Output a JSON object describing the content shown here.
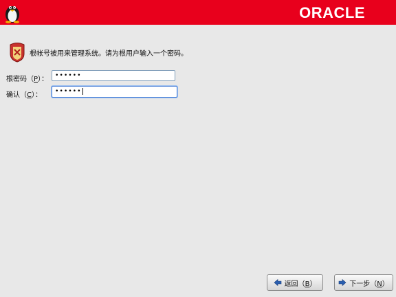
{
  "banner": {
    "logo_text": "ORACLE",
    "color": "#e8001c"
  },
  "content": {
    "intro_text": "根帐号被用来管理系统。请为根用户输入一个密码。"
  },
  "form": {
    "root_password": {
      "label_prefix": "根密码（",
      "mnemonic": "P",
      "label_suffix": "）：",
      "value_masked": "••••••"
    },
    "confirm": {
      "label_prefix": "确认（",
      "mnemonic": "C",
      "label_suffix": "）：",
      "value_masked": "••••••"
    }
  },
  "buttons": {
    "back": {
      "label_prefix": "返回（",
      "mnemonic": "B",
      "label_suffix": "）",
      "icon": "arrow-left-icon"
    },
    "next": {
      "label_prefix": "下一步（",
      "mnemonic": "N",
      "label_suffix": "）",
      "icon": "arrow-right-icon"
    }
  }
}
